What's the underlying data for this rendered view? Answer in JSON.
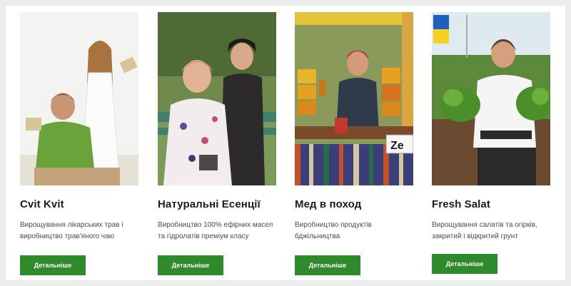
{
  "cards": [
    {
      "title": "Cvit Kvit",
      "description": "Вирощування лікарських трав і виробництво трав'яного чаю",
      "button_label": "Детальніше",
      "photo_alt": "photo-two-women-with-tea"
    },
    {
      "title": "Натуральні Есенції",
      "description": "Виробництво 100% ефірних масел та гідролатів преміум класу",
      "button_label": "Детальніше",
      "photo_alt": "photo-two-women-on-bench"
    },
    {
      "title": "Мед в поход",
      "description": "Виробництво продуктів бджільництва",
      "button_label": "Детальніше",
      "photo_alt": "photo-woman-at-honey-stall",
      "sign_text": "Ze"
    },
    {
      "title": "Fresh Salat",
      "description": "Вирощування салатів та огірків, закритий і відкритий грунт",
      "button_label": "Детальніше",
      "photo_alt": "photo-woman-with-lettuce"
    }
  ],
  "colors": {
    "button_green": "#2f8a2c",
    "flag_blue": "#1f5fbf",
    "flag_yellow": "#f4d21f"
  }
}
